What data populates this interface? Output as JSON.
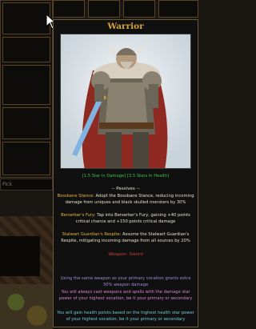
{
  "background": {
    "search_placeholder": "Pick"
  },
  "tooltip": {
    "title": "Warrior",
    "stars_text": "[1.5 Star in Damage] [3.5 Stars in Health]",
    "passives_header": "-- Passives --",
    "passives": [
      {
        "name": "Bossbane Stance:",
        "text": " Adopt the Bossbane Stance, reducing incoming damage from uniques and black skulled monsters by 30%"
      },
      {
        "name": "Berserker's Fury:",
        "text": " Tap into Berserker's Fury, gaining +40 points critical chance and +150 points critical damage"
      },
      {
        "name": "Stalwart Guardian's Respite:",
        "text": " Assume the Stalwart Guardian's Respite, mitigating incoming damage from all sources by 20%"
      }
    ],
    "weapon_header": "Weapon: Sword",
    "notes": [
      "Using the same weapon as your primary vocation grants extra 30% weapon damage",
      "You will always cast weapons and spells with the damage star power of your highest vocation, be it your primary or secondary",
      "You will gain health points based on the highest health star power of your highest vocation, be it your primary or secondary"
    ]
  },
  "colors": {
    "title": "#d7a33c",
    "stars": "#39c14a",
    "passive_name": "#e4b73a",
    "weapon_header": "#c8402e",
    "note_1": "#a38bd8",
    "note_2": "#d884d0",
    "note_3": "#6fc6d8"
  }
}
